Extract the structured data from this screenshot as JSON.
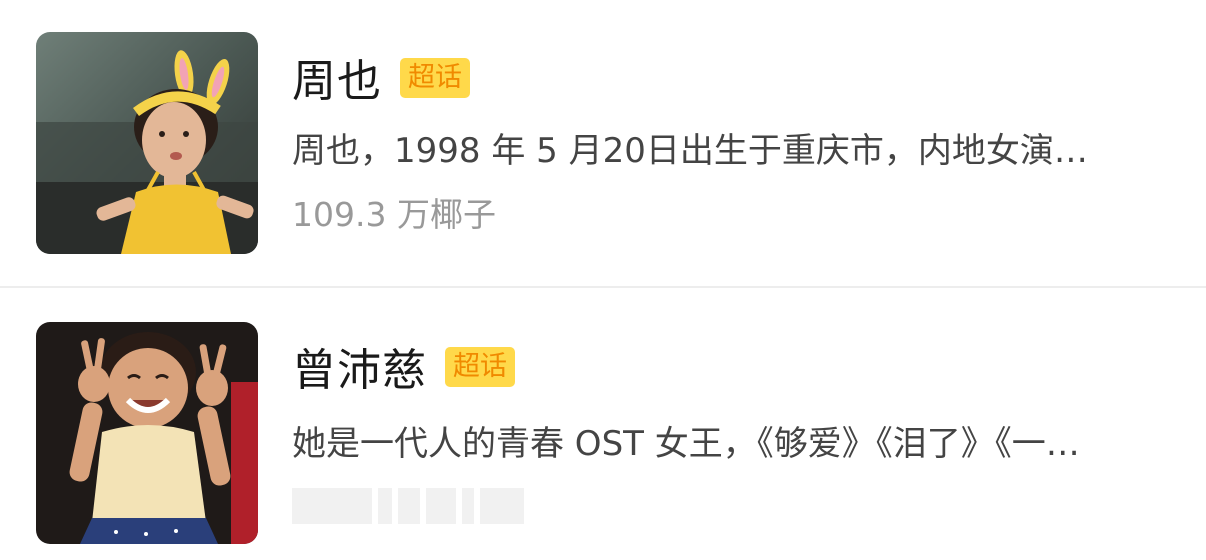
{
  "items": [
    {
      "title": "周也",
      "badge": "超话",
      "description": "周也，1998 年 5 月20日出生于重庆市，内地女演…",
      "meta": "109.3 万椰子",
      "image": "childhood-photo-bunny-ears"
    },
    {
      "title": "曾沛慈",
      "badge": "超话",
      "description": "她是一代人的青春 OST 女王，《够爱》《泪了》《一…",
      "meta": "",
      "image": "childhood-photo-peace-signs"
    }
  ],
  "colors": {
    "badge_bg": "#ffd94a",
    "badge_text": "#f08a00",
    "title": "#1a1a1a",
    "description": "#444444",
    "meta": "#999999",
    "divider": "#ededed"
  }
}
